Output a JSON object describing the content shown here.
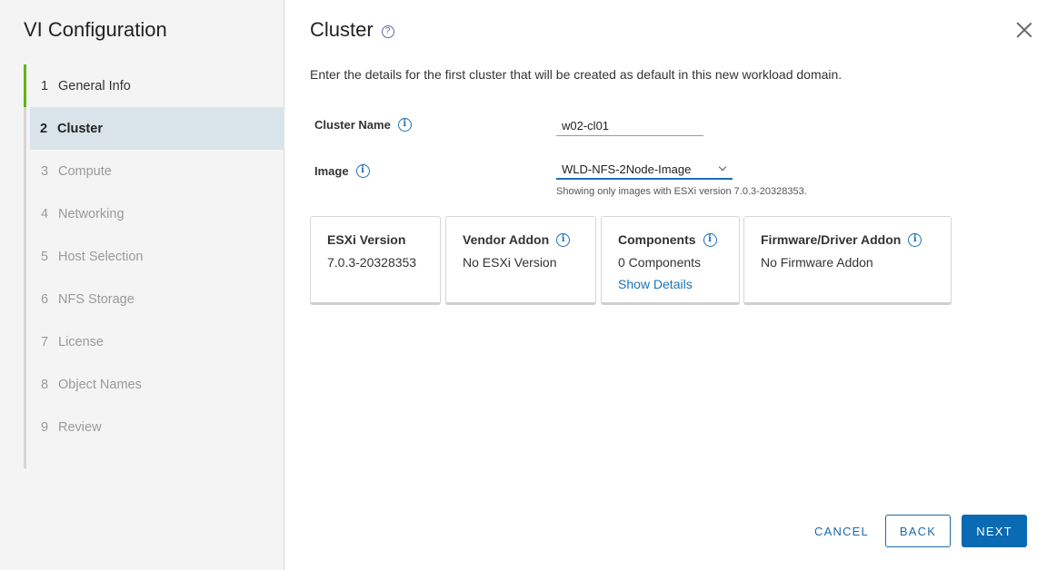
{
  "sidebar": {
    "title": "VI Configuration",
    "steps": [
      {
        "num": "1",
        "label": "General Info"
      },
      {
        "num": "2",
        "label": "Cluster"
      },
      {
        "num": "3",
        "label": "Compute"
      },
      {
        "num": "4",
        "label": "Networking"
      },
      {
        "num": "5",
        "label": "Host Selection"
      },
      {
        "num": "6",
        "label": "NFS Storage"
      },
      {
        "num": "7",
        "label": "License"
      },
      {
        "num": "8",
        "label": "Object Names"
      },
      {
        "num": "9",
        "label": "Review"
      }
    ]
  },
  "main": {
    "title": "Cluster",
    "help_glyph": "?",
    "description": "Enter the details for the first cluster that will be created as default in this new workload domain.",
    "cluster_name_label": "Cluster Name",
    "cluster_name_value": "w02-cl01",
    "image_label": "Image",
    "image_value": "WLD-NFS-2Node-Image",
    "image_helper": "Showing only images with ESXi version 7.0.3-20328353.",
    "info_glyph": "i",
    "cards": {
      "esxi": {
        "title": "ESXi Version",
        "value": "7.0.3-20328353"
      },
      "vendor": {
        "title": "Vendor Addon",
        "value": "No ESXi Version"
      },
      "components": {
        "title": "Components",
        "value": "0 Components",
        "link": "Show Details"
      },
      "firmware": {
        "title": "Firmware/Driver Addon",
        "value": "No Firmware Addon"
      }
    }
  },
  "footer": {
    "cancel_label": "CANCEL",
    "back_label": "BACK",
    "next_label": "NEXT"
  },
  "colors": {
    "accent": "#0a6ab3",
    "step_done": "#60b515",
    "step_active_bg": "#d9e4ea"
  }
}
